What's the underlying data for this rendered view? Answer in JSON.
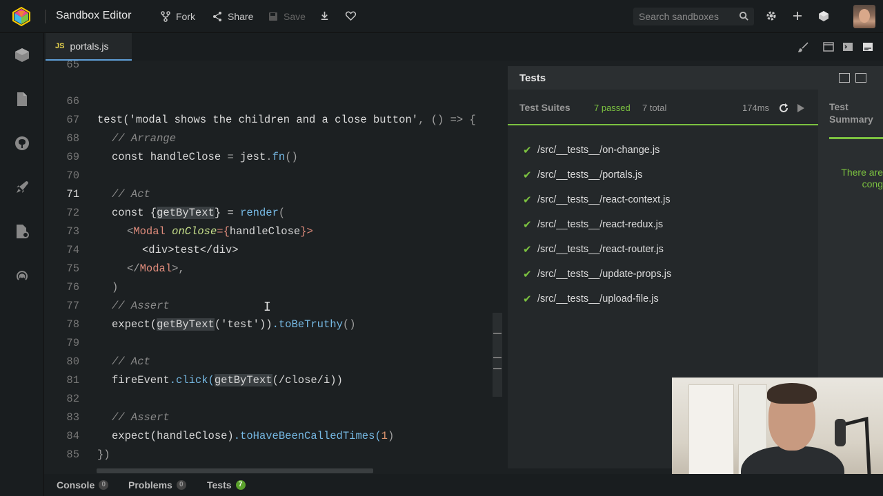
{
  "app_title": "Sandbox Editor",
  "toolbar": {
    "fork_label": "Fork",
    "share_label": "Share",
    "save_label": "Save",
    "search_placeholder": "Search sandboxes"
  },
  "file_tab": {
    "badge": "JS",
    "name": "portals.js"
  },
  "editor": {
    "active_line": 71,
    "lines": [
      {
        "n": "65"
      },
      {
        "n": "66"
      },
      {
        "n": "67"
      },
      {
        "n": "68"
      },
      {
        "n": "69"
      },
      {
        "n": "70"
      },
      {
        "n": "71"
      },
      {
        "n": "72"
      },
      {
        "n": "73"
      },
      {
        "n": "74"
      },
      {
        "n": "75"
      },
      {
        "n": "76"
      },
      {
        "n": "77"
      },
      {
        "n": "78"
      },
      {
        "n": "79"
      },
      {
        "n": "80"
      },
      {
        "n": "81"
      },
      {
        "n": "82"
      },
      {
        "n": "83"
      },
      {
        "n": "84"
      },
      {
        "n": "85"
      }
    ],
    "code": {
      "l66_a": "test(",
      "l66_b": "'modal shows the children and a close button'",
      "l66_c": ", () => {",
      "l67": "// Arrange",
      "l68_a": "const ",
      "l68_b": "handleClose",
      "l68_c": " = ",
      "l68_d": "jest",
      "l68_e": ".",
      "l68_f": "fn",
      "l68_g": "()",
      "l70": "// Act",
      "l71_a": "const {",
      "l71_b": "getByText",
      "l71_c": "} = ",
      "l71_d": "render",
      "l71_e": "(",
      "l72_a": "<",
      "l72_b": "Modal",
      "l72_c": " ",
      "l72_d": "onClose",
      "l72_e": "={",
      "l72_f": "handleClose",
      "l72_g": "}>",
      "l73": "<div>test</div>",
      "l74_a": "</",
      "l74_b": "Modal",
      "l74_c": ">,",
      "l75": ")",
      "l76": "// Assert",
      "l77_a": "expect(",
      "l77_b": "getByText",
      "l77_c": "('test'))",
      "l77_d": ".toBeTruthy",
      "l77_e": "()",
      "l79": "// Act",
      "l80_a": "fireEvent",
      "l80_b": ".click(",
      "l80_c": "getByText",
      "l80_d": "(/close/i))",
      "l82": "// Assert",
      "l83_a": "expect(handleClose)",
      "l83_b": ".toHaveBeenCalledTimes(",
      "l83_c": "1",
      "l83_d": ")",
      "l84": "})"
    }
  },
  "tests_panel": {
    "title": "Tests",
    "suites_label": "Test Suites",
    "passed": "7 passed",
    "total": "7 total",
    "time": "174ms",
    "summary_tab": "Test Summary",
    "summary_text": "There are cong",
    "suites": [
      "/src/__tests__/on-change.js",
      "/src/__tests__/portals.js",
      "/src/__tests__/react-context.js",
      "/src/__tests__/react-redux.js",
      "/src/__tests__/react-router.js",
      "/src/__tests__/update-props.js",
      "/src/__tests__/upload-file.js"
    ],
    "accent_color": "#7cc240"
  },
  "bottom_bar": {
    "console_label": "Console",
    "console_count": "0",
    "problems_label": "Problems",
    "problems_count": "0",
    "tests_label": "Tests",
    "tests_count": "7"
  }
}
